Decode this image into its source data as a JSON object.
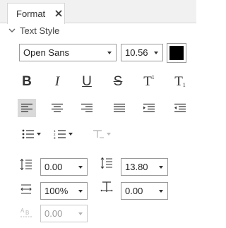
{
  "tab": {
    "label": "Format",
    "close_icon": "close-icon"
  },
  "section": {
    "title": "Text Style",
    "caret_icon": "caret-down-icon"
  },
  "font": {
    "family": "Open Sans",
    "size": "10.56",
    "color": "#000000"
  },
  "formatting": {
    "bold": "B",
    "italic": "I",
    "underline": "U",
    "strikethrough": "S",
    "superscript_base": "T",
    "superscript_mark": "1",
    "subscript_base": "T",
    "subscript_mark": "1"
  },
  "alignment": {
    "active": "align-left",
    "options": [
      "align-left",
      "align-center",
      "align-right",
      "justify",
      "indent-increase",
      "indent-decrease"
    ]
  },
  "lists": {
    "bullet_icon": "bullet-list-icon",
    "numbered_icon": "numbered-list-icon",
    "clear_format_icon": "clear-format-icon"
  },
  "spacing": {
    "paragraph_spacing": "0.00",
    "line_spacing": "13.80",
    "char_scale": "100%",
    "char_spacing": "0.00",
    "baseline_offset": "0.00"
  },
  "colors": {
    "accent": "#2f74c8",
    "active_bg": "#d9d9d9",
    "icon": "#333333",
    "disabled": "#bbbbbb"
  }
}
